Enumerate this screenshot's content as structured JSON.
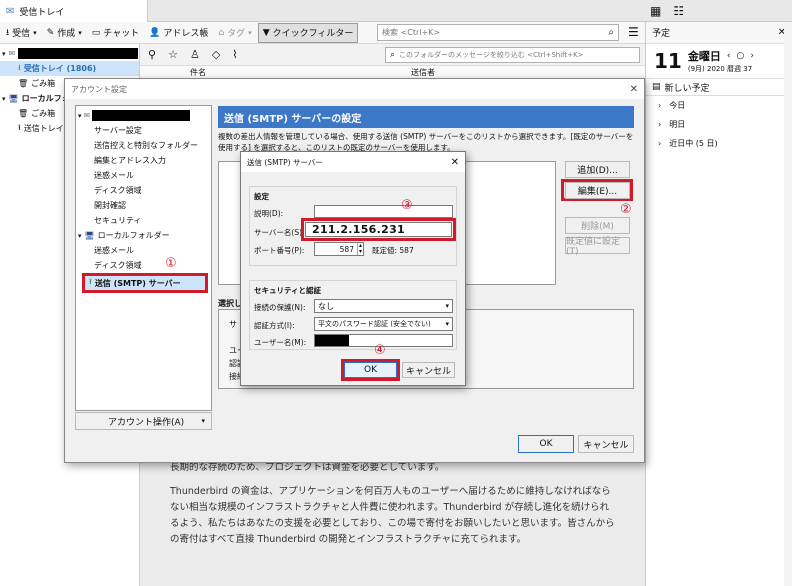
{
  "window": {
    "tab_title": "受信トレイ"
  },
  "toolbar": {
    "get_mail": "受信",
    "write": "作成",
    "chat": "チャット",
    "address_book": "アドレス帳",
    "tag": "タグ",
    "quick_filter": "クイックフィルター",
    "search_placeholder": "検索 <Ctrl+K>",
    "filter_placeholder": "このフォルダーのメッセージを絞り込む <Ctrl+Shift+K>"
  },
  "folders": {
    "inbox_label": "受信トレイ (1806)",
    "trash": "ごみ箱",
    "local_folders": "ローカルフォルダー",
    "outbox": "送信トレイ"
  },
  "thread_header": {
    "subject": "件名",
    "sender": "送信者"
  },
  "calendar": {
    "header": "予定",
    "day_number": "11",
    "day_name": "金曜日",
    "date_sub": "(9月) 2020 暦週 37",
    "new_event": "新しい予定",
    "groups": [
      "今日",
      "明日",
      "近日中 (5 日)"
    ]
  },
  "message_body": {
    "paragraph1": "長期的な存続のため、プロジェクトは資金を必要としています。",
    "paragraph2": "Thunderbird の資金は、アプリケーションを何百万人ものユーザーへ届けるために維持しなければならない相当な規模のインフラストラクチャと人件費に使われます。Thunderbird が存続し進化を続けられるよう、私たちはあなたの支援を必要としており、この場で寄付をお願いしたいと思います。皆さんからの寄付はすべて直接 Thunderbird の開発とインフラストラクチャに充てられます。"
  },
  "account_settings": {
    "title": "アカウント設定",
    "tree": [
      "サーバー設定",
      "送信控えと特別なフォルダー",
      "編集とアドレス入力",
      "迷惑メール",
      "ディスク領域",
      "開封確認",
      "セキュリティ"
    ],
    "local_folders": "ローカルフォルダー",
    "local_tree": [
      "迷惑メール",
      "ディスク領域"
    ],
    "smtp_item": "送信 (SMTP) サーバー",
    "account_actions": "アカウント操作(A)",
    "panel_title": "送信 (SMTP) サーバーの設定",
    "description": "複数の差出人情報を管理している場合、使用する送信 (SMTP) サーバーをこのリストから選択できます。[既定のサーバーを使用する] を選択すると、このリストの既定のサーバーを使用します。",
    "buttons": {
      "add": "追加(D)...",
      "edit": "編集(E)...",
      "remove": "削除(M)",
      "set_default": "既定値に設定(T)"
    },
    "details_label": "選択し",
    "details_lines": [
      "サ",
      "ユー",
      "認証",
      "接続"
    ],
    "ok": "OK",
    "cancel": "キャンセル"
  },
  "smtp_dialog": {
    "title": "送信 (SMTP) サーバー",
    "settings_group": "設定",
    "description_label": "説明(D):",
    "server_label": "サーバー名(S):",
    "server_value": "211.2.156.231",
    "port_label": "ポート番号(P):",
    "port_value": "587",
    "default_port": "既定値:  587",
    "security_group": "セキュリティと認証",
    "conn_label": "接続の保護(N):",
    "conn_value": "なし",
    "auth_label": "認証方式(I):",
    "auth_value": "平文のパスワード認証 (安全でない)",
    "user_label": "ユーザー名(M):",
    "ok": "OK",
    "cancel": "キャンセル"
  },
  "markers": [
    "①",
    "②",
    "③",
    "④"
  ],
  "colors": {
    "accent": "#3c78c8",
    "annotation": "#d11a2a",
    "selected": "#cde4fa"
  }
}
